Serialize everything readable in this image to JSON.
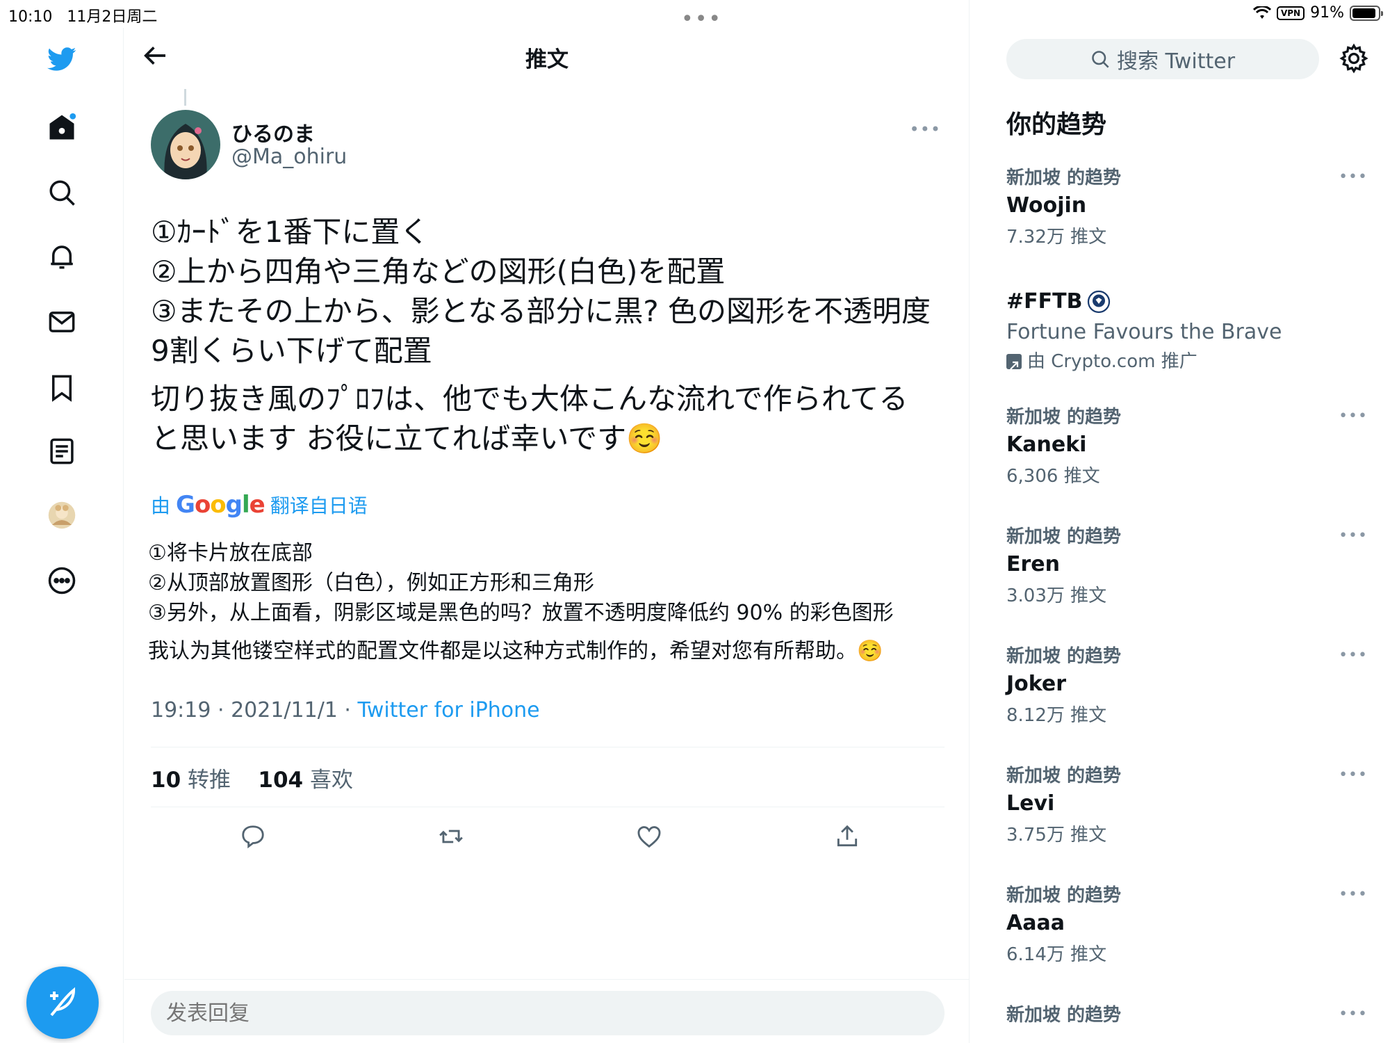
{
  "status_bar": {
    "time": "10:10",
    "date": "11月2日周二",
    "vpn": "VPN",
    "battery": "91%",
    "battery_level": 0.91
  },
  "header": {
    "title": "推文"
  },
  "tweet": {
    "author_name": "ひるのま",
    "author_handle": "@Ma_ohiru",
    "text_lines": [
      "①ｶｰﾄﾞを1番下に置く\n②上から四角や三角などの図形(白色)を配置\n③またその上から、影となる部分に黒? 色の図形を不透明度9割くらい下げて配置",
      "切り抜き風のﾌﾟﾛﾌは、他でも大体こんな流れで作られてると思います お役に立てれば幸いです☺️"
    ],
    "translate_prefix": "由",
    "translate_brand": "Google",
    "translate_suffix": "翻译自日语",
    "translated_lines": [
      "①将卡片放在底部\n②从顶部放置图形（白色），例如正方形和三角形\n③另外，从上面看，阴影区域是黑色的吗？放置不透明度降低约 90% 的彩色图形",
      "我认为其他镂空样式的配置文件都是以这种方式制作的，希望对您有所帮助。☺️"
    ],
    "meta_time": "19:19 · 2021/11/1 · ",
    "meta_source": "Twitter for iPhone",
    "retweet_count": "10",
    "retweet_label": " 转推",
    "like_count": "104",
    "like_label": " 喜欢"
  },
  "reply": {
    "placeholder": "发表回复"
  },
  "sidebar_right": {
    "search_placeholder": "搜索 Twitter",
    "trends_title": "你的趋势",
    "trends": [
      {
        "context": "新加坡 的趋势",
        "name": "Woojin",
        "count": "7.32万 推文"
      },
      {
        "context": "新加坡 的趋势",
        "name": "Kaneki",
        "count": "6,306 推文"
      },
      {
        "context": "新加坡 的趋势",
        "name": "Eren",
        "count": "3.03万 推文"
      },
      {
        "context": "新加坡 的趋势",
        "name": "Joker",
        "count": "8.12万 推文"
      },
      {
        "context": "新加坡 的趋势",
        "name": "Levi",
        "count": "3.75万 推文"
      },
      {
        "context": "新加坡 的趋势",
        "name": "Aaaa",
        "count": "6.14万 推文"
      },
      {
        "context": "新加坡 的趋势"
      }
    ],
    "promoted": {
      "name": "#FFTB",
      "description": "Fortune Favours the Brave",
      "by": "由 Crypto.com 推广"
    }
  },
  "colors": {
    "accent": "#1d9bf0",
    "secondary_text": "#536471"
  }
}
